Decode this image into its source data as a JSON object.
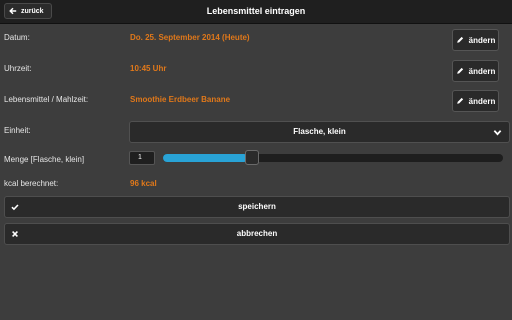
{
  "header": {
    "back_label": "zurück",
    "title": "Lebensmittel eintragen"
  },
  "form": {
    "date": {
      "label": "Datum:",
      "value": "Do. 25. September 2014 (Heute)",
      "edit_label": "ändern"
    },
    "time": {
      "label": "Uhrzeit:",
      "value": "10:45 Uhr",
      "edit_label": "ändern"
    },
    "food": {
      "label": "Lebensmittel / Mahlzeit:",
      "value": "Smoothie Erdbeer Banane",
      "edit_label": "ändern"
    },
    "unit": {
      "label": "Einheit:",
      "selected": "Flasche, klein"
    },
    "quantity": {
      "label": "Menge [Flasche, klein]",
      "value": "1",
      "slider_fraction": 0.25
    },
    "kcal": {
      "label": "kcal berechnet:",
      "value": "96 kcal"
    }
  },
  "actions": {
    "save_label": "speichern",
    "cancel_label": "abbrechen"
  },
  "colors": {
    "accent": "#e0781a",
    "slider": "#29a3d6",
    "background": "#3d3d3d",
    "header": "#1f1f1f"
  },
  "icons": {
    "back": "arrow-left-icon",
    "edit": "pencil-icon",
    "select": "chevron-down-icon",
    "save": "check-icon",
    "cancel": "close-icon"
  }
}
